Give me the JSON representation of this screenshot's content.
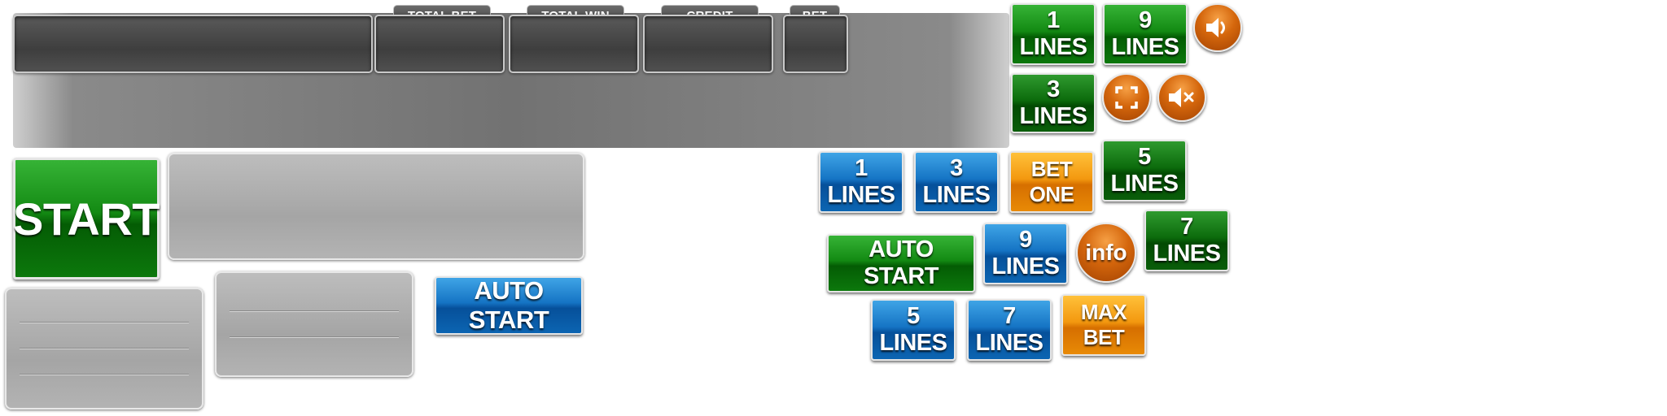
{
  "top_bar": {
    "labels": {
      "total_bet": "TOTAL BET",
      "total_win": "TOTAL WIN",
      "credit": "CREDIT",
      "bet": "BET"
    }
  },
  "buttons": {
    "start": "START",
    "auto_start_blue": "AUTO START",
    "auto_start_green": "AUTO START",
    "green_1_lines": "1 LINES",
    "green_9_lines": "9 LINES",
    "green_3_lines": "3 LINES",
    "green_5_lines": "5 LINES",
    "green_7_lines": "7 LINES",
    "blue_1_lines": "1 LINES",
    "blue_3_lines": "3 LINES",
    "blue_9_lines": "9 LINES",
    "blue_5_lines": "5 LINES",
    "blue_7_lines": "7 LINES",
    "bet_one": "BET ONE",
    "max_bet": "MAX BET",
    "info": "info"
  },
  "icons": {
    "sound_on": "speaker-icon",
    "fullscreen": "fullscreen-icon",
    "sound_off": "speaker-mute-icon"
  },
  "colors": {
    "green": "#138a13",
    "blue": "#1574c4",
    "orange": "#f3980f",
    "round_orange": "#d4660c",
    "panel_gray": "#727272"
  }
}
